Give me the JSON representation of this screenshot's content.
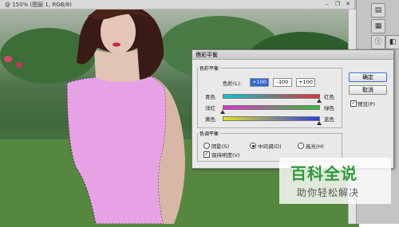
{
  "window": {
    "title": "@ 150% (图层 1, RGB/8)"
  },
  "window_controls": {
    "minimize": "–",
    "restore": "❐",
    "close": "✕"
  },
  "dialog": {
    "title": "色彩平衡",
    "close_glyph": "✕",
    "color_balance_group": "色彩平衡",
    "levels_label": "色阶(L):",
    "levels": [
      "+100",
      "-100",
      "+100"
    ],
    "sliders": [
      {
        "left": "青色",
        "right": "红色",
        "value": 100
      },
      {
        "left": "洋红",
        "right": "绿色",
        "value": -100
      },
      {
        "left": "黄色",
        "right": "蓝色",
        "value": 100
      }
    ],
    "tone_group": "色调平衡",
    "tones": [
      {
        "label": "阴影(S)",
        "selected": false
      },
      {
        "label": "中间调(D)",
        "selected": true
      },
      {
        "label": "高光(H)",
        "selected": false
      }
    ],
    "preserve_luminosity": {
      "label": "保持明度(V)",
      "checked": true
    },
    "ok": "确定",
    "cancel": "取消",
    "preview": {
      "label": "预览(P)",
      "checked": true
    }
  },
  "watermark": {
    "title": "百科全说",
    "subtitle": "助你轻松解决"
  },
  "colors": {
    "dress": "#e7a2e6",
    "accent_green": "#2f9a3a",
    "selection": "#3367d6"
  }
}
